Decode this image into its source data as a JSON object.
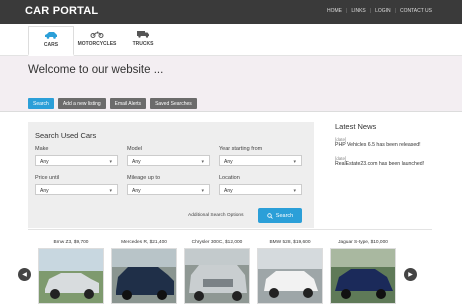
{
  "header": {
    "logo": "CAR PORTAL",
    "nav": [
      "HOME",
      "LINKS",
      "LOGIN",
      "CONTACT US"
    ]
  },
  "categories": [
    {
      "label": "CARS",
      "icon": "car-icon"
    },
    {
      "label": "MOTORCYCLES",
      "icon": "motorcycle-icon"
    },
    {
      "label": "TRUCKS",
      "icon": "truck-icon"
    }
  ],
  "hero": {
    "welcome": "Welcome to our website ..."
  },
  "tabs": [
    "Search",
    "Add a new listing",
    "Email Alerts",
    "Saved Searches"
  ],
  "search": {
    "title": "Search Used Cars",
    "fields": [
      {
        "label": "Make",
        "value": "Any"
      },
      {
        "label": "Model",
        "value": "Any"
      },
      {
        "label": "Year starting from",
        "value": "Any"
      },
      {
        "label": "Price until",
        "value": "Any"
      },
      {
        "label": "Mileage up to",
        "value": "Any"
      },
      {
        "label": "Location",
        "value": "Any"
      }
    ],
    "advanced": "Additional Search Options",
    "button": "Search"
  },
  "news": {
    "title": "Latest News",
    "items": [
      {
        "date": "[date]",
        "text": "PHP Vehicles 6.5 has been released!"
      },
      {
        "date": "[date]",
        "text": "RealEstate23.com has been launched!"
      }
    ]
  },
  "listings": [
    {
      "caption": "Bmw Z3, $9,700",
      "color": "#b9c2c6",
      "body": "#d8dcde"
    },
    {
      "caption": "Mercedes R, $21,400",
      "color": "#2b3a52",
      "body": "#1f2f48"
    },
    {
      "caption": "Chrysler 300C, $12,000",
      "color": "#9aa3a7",
      "body": "#c9ced0"
    },
    {
      "caption": "BMW 528, $19,600",
      "color": "#c7ccd0",
      "body": "#f2f2f2"
    },
    {
      "caption": "Jaguar S-type, $10,000",
      "color": "#1f2d5c",
      "body": "#1b2a5a"
    }
  ],
  "carousel": {
    "prev": "◀",
    "next": "▶"
  }
}
